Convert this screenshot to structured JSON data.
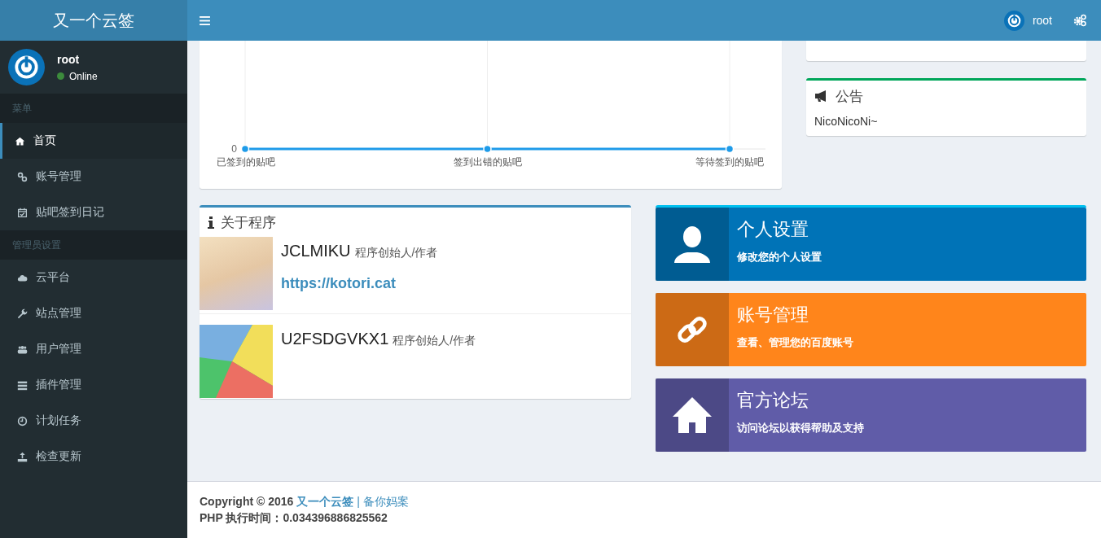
{
  "header": {
    "brand": "又一个云签",
    "user_name": "root"
  },
  "sidebar": {
    "user": {
      "name": "root",
      "status": "Online"
    },
    "sections": [
      {
        "title": "菜单",
        "items": [
          {
            "label": "首页",
            "selected": true
          },
          {
            "label": "账号管理",
            "selected": false
          },
          {
            "label": "贴吧签到日记",
            "selected": false
          }
        ]
      },
      {
        "title": "管理员设置",
        "items": [
          {
            "label": "云平台",
            "selected": false
          },
          {
            "label": "站点管理",
            "selected": false
          },
          {
            "label": "用户管理",
            "selected": false
          },
          {
            "label": "插件管理",
            "selected": false
          },
          {
            "label": "计划任务",
            "selected": false
          },
          {
            "label": "检查更新",
            "selected": false
          }
        ]
      }
    ]
  },
  "chart_card": {
    "y_axis_label": "0",
    "categories": [
      "已签到的贴吧",
      "签到出错的贴吧",
      "等待签到的贴吧"
    ]
  },
  "notice": {
    "title": "公告",
    "text": "NicoNicoNi~"
  },
  "about": {
    "title": "关于程序",
    "authors": [
      {
        "name": "JCLMIKU",
        "role": "程序创始人/作者",
        "link": "https://kotori.cat"
      },
      {
        "name": "U2FSDGVKX1",
        "role": "程序创始人/作者"
      }
    ]
  },
  "tiles": [
    {
      "title": "个人设置",
      "subtitle": "修改您的个人设置",
      "color": "#0073b7"
    },
    {
      "title": "账号管理",
      "subtitle": "查看、管理您的百度账号",
      "color": "#ff851b"
    },
    {
      "title": "官方论坛",
      "subtitle": "访问论坛以获得帮助及支持",
      "color": "#605ca8"
    }
  ],
  "footer": {
    "copyright": "Copyright © 2016",
    "site_link": "又一个云签",
    "separator": "|",
    "icp_link": "备你妈案",
    "exec_time": "PHP 执行时间：0.034396886825562"
  }
}
